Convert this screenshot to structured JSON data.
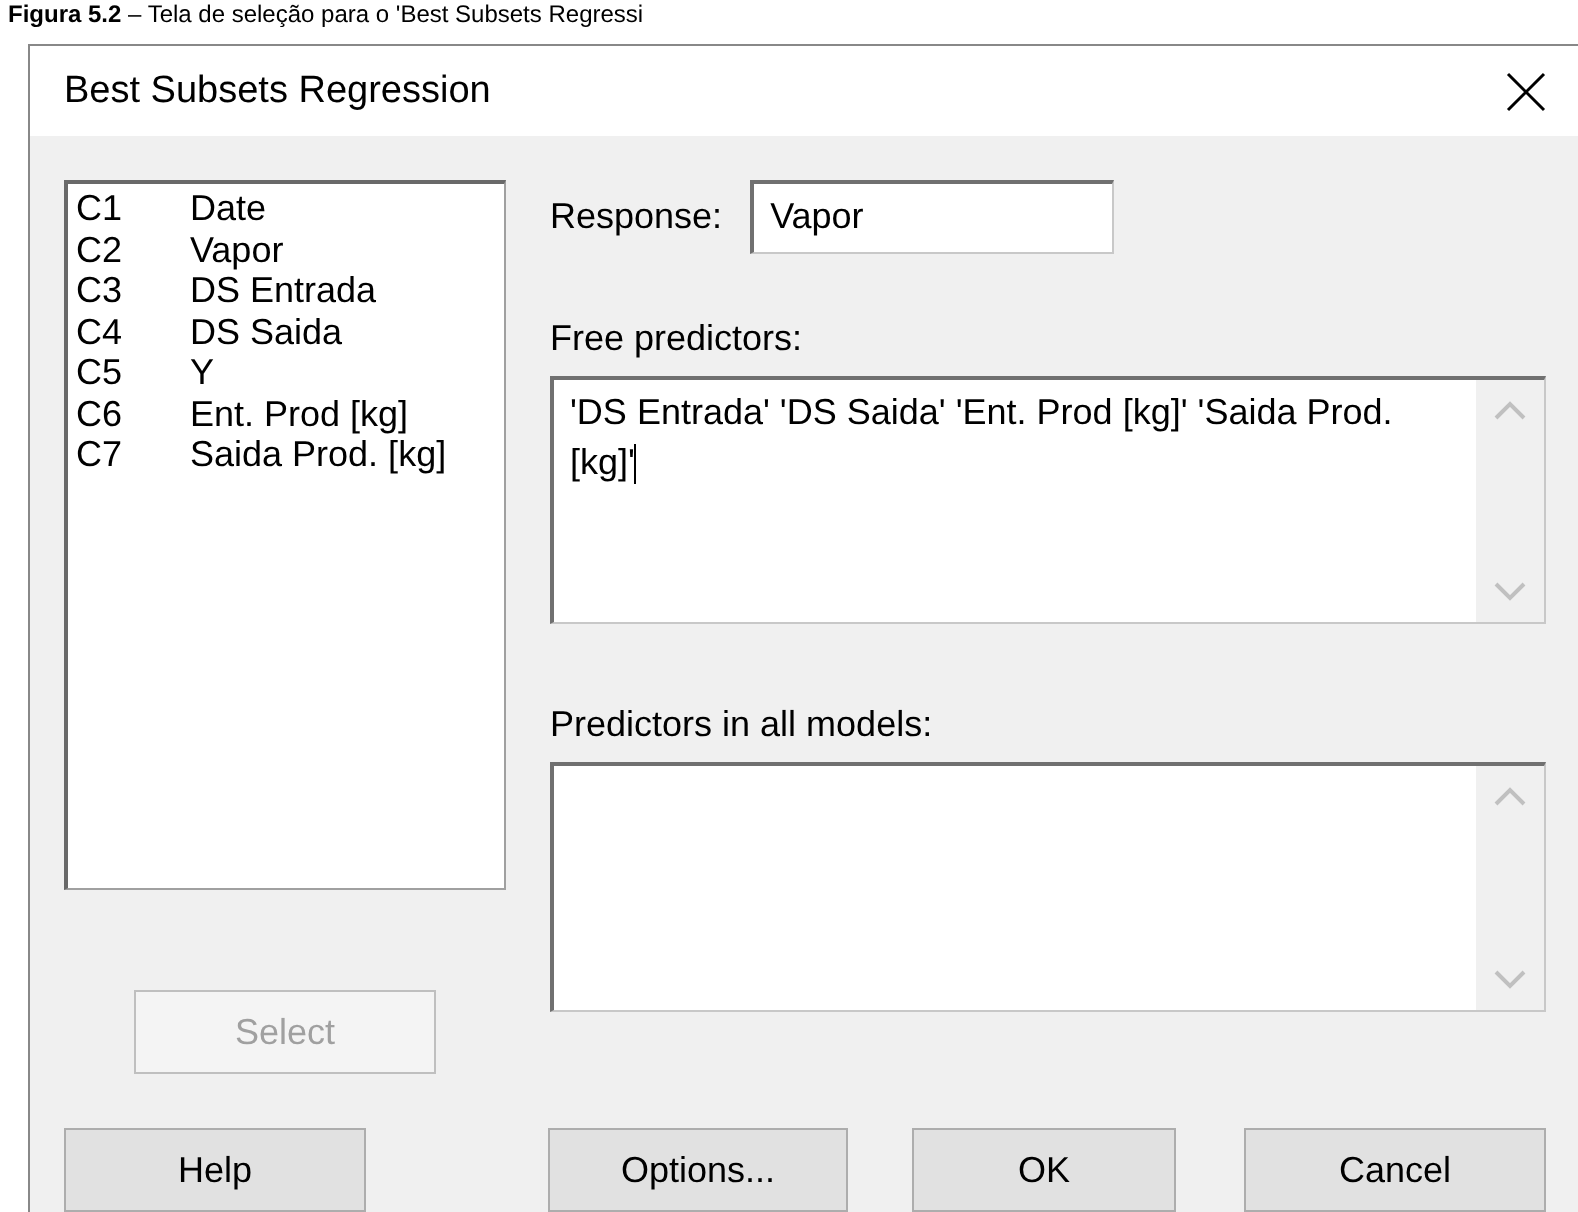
{
  "caption": "**Figura 5.2** – Tela de seleção para o 'Best Subsets Regressi",
  "window": {
    "title": "Best Subsets Regression"
  },
  "columns": [
    {
      "id": "C1",
      "name": "Date"
    },
    {
      "id": "C2",
      "name": "Vapor"
    },
    {
      "id": "C3",
      "name": "DS Entrada"
    },
    {
      "id": "C4",
      "name": "DS Saida"
    },
    {
      "id": "C5",
      "name": "Y"
    },
    {
      "id": "C6",
      "name": "Ent. Prod [kg]"
    },
    {
      "id": "C7",
      "name": "Saida Prod. [kg]"
    }
  ],
  "response": {
    "label": "Response:",
    "value": "Vapor"
  },
  "free_predictors": {
    "label": "Free predictors:",
    "value": "'DS Entrada' 'DS Saida' 'Ent. Prod [kg]' 'Saida Prod. [kg]'"
  },
  "predictors_in_all_models": {
    "label": "Predictors in all models:"
  },
  "select_button": {
    "label": "Select",
    "disabled": true
  },
  "buttons": [
    {
      "label": "Help"
    },
    {
      "label": "Options..."
    },
    {
      "label": "OK"
    },
    {
      "label": "Cancel"
    }
  ]
}
